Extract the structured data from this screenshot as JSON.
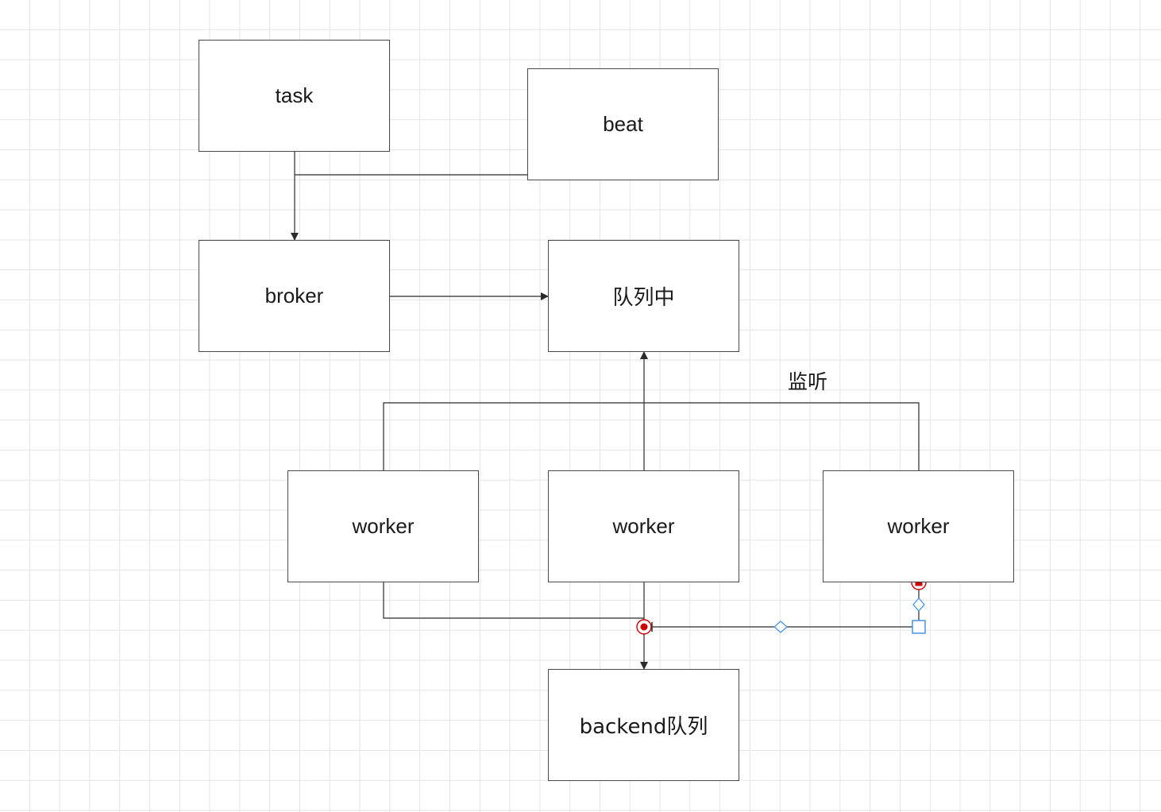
{
  "diagram": {
    "nodes": {
      "task": "task",
      "beat": "beat",
      "broker": "broker",
      "queue": "队列中",
      "worker_left": "worker",
      "worker_center": "worker",
      "worker_right": "worker",
      "backend": "backend队列"
    },
    "edge_labels": {
      "listen": "监听"
    }
  },
  "colors": {
    "line": "#2b2b2b",
    "grid": "#e4e4e4",
    "handle_red": "#cc0000",
    "handle_blue": "#3a8ee6"
  }
}
